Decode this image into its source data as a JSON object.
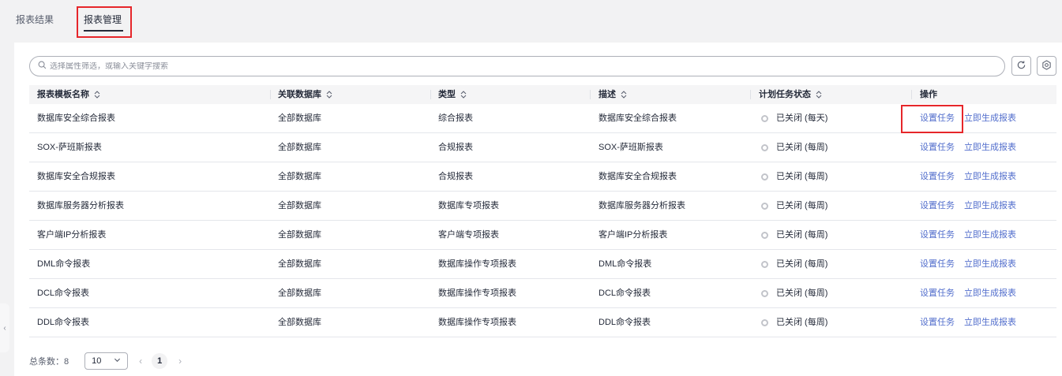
{
  "tabs": [
    {
      "label": "报表结果"
    },
    {
      "label": "报表管理"
    }
  ],
  "search": {
    "placeholder": "选择属性筛选，或输入关键字搜索"
  },
  "columns": [
    {
      "label": "报表模板名称",
      "sortable": true
    },
    {
      "label": "关联数据库",
      "sortable": true
    },
    {
      "label": "类型",
      "sortable": true
    },
    {
      "label": "描述",
      "sortable": true
    },
    {
      "label": "计划任务状态",
      "sortable": true
    },
    {
      "label": "操作",
      "sortable": false
    }
  ],
  "rows": [
    {
      "name": "数据库安全综合报表",
      "db": "全部数据库",
      "type": "综合报表",
      "desc": "数据库安全综合报表",
      "status": "已关闭 (每天)",
      "op1": "设置任务",
      "op2": "立即生成报表"
    },
    {
      "name": "SOX-萨班斯报表",
      "db": "全部数据库",
      "type": "合规报表",
      "desc": "SOX-萨班斯报表",
      "status": "已关闭 (每周)",
      "op1": "设置任务",
      "op2": "立即生成报表"
    },
    {
      "name": "数据库安全合规报表",
      "db": "全部数据库",
      "type": "合规报表",
      "desc": "数据库安全合规报表",
      "status": "已关闭 (每周)",
      "op1": "设置任务",
      "op2": "立即生成报表"
    },
    {
      "name": "数据库服务器分析报表",
      "db": "全部数据库",
      "type": "数据库专项报表",
      "desc": "数据库服务器分析报表",
      "status": "已关闭 (每周)",
      "op1": "设置任务",
      "op2": "立即生成报表"
    },
    {
      "name": "客户端IP分析报表",
      "db": "全部数据库",
      "type": "客户端专项报表",
      "desc": "客户端IP分析报表",
      "status": "已关闭 (每周)",
      "op1": "设置任务",
      "op2": "立即生成报表"
    },
    {
      "name": "DML命令报表",
      "db": "全部数据库",
      "type": "数据库操作专项报表",
      "desc": "DML命令报表",
      "status": "已关闭 (每周)",
      "op1": "设置任务",
      "op2": "立即生成报表"
    },
    {
      "name": "DCL命令报表",
      "db": "全部数据库",
      "type": "数据库操作专项报表",
      "desc": "DCL命令报表",
      "status": "已关闭 (每周)",
      "op1": "设置任务",
      "op2": "立即生成报表"
    },
    {
      "name": "DDL命令报表",
      "db": "全部数据库",
      "type": "数据库操作专项报表",
      "desc": "DDL命令报表",
      "status": "已关闭 (每周)",
      "op1": "设置任务",
      "op2": "立即生成报表"
    }
  ],
  "footer": {
    "total_label": "总条数：",
    "total": "8",
    "page_size": "10",
    "current_page": "1"
  },
  "icons": {
    "search": "search-icon",
    "refresh": "refresh-icon",
    "settings": "settings-icon",
    "sort": "sort-icon",
    "collapse": "chevron-left-icon",
    "prev": "chevron-left-icon",
    "next": "chevron-right-icon",
    "dropdown": "chevron-down-icon"
  },
  "colors": {
    "link": "#526ecc",
    "highlight": "#e6262a",
    "status_dot": "#c2c4ca"
  }
}
